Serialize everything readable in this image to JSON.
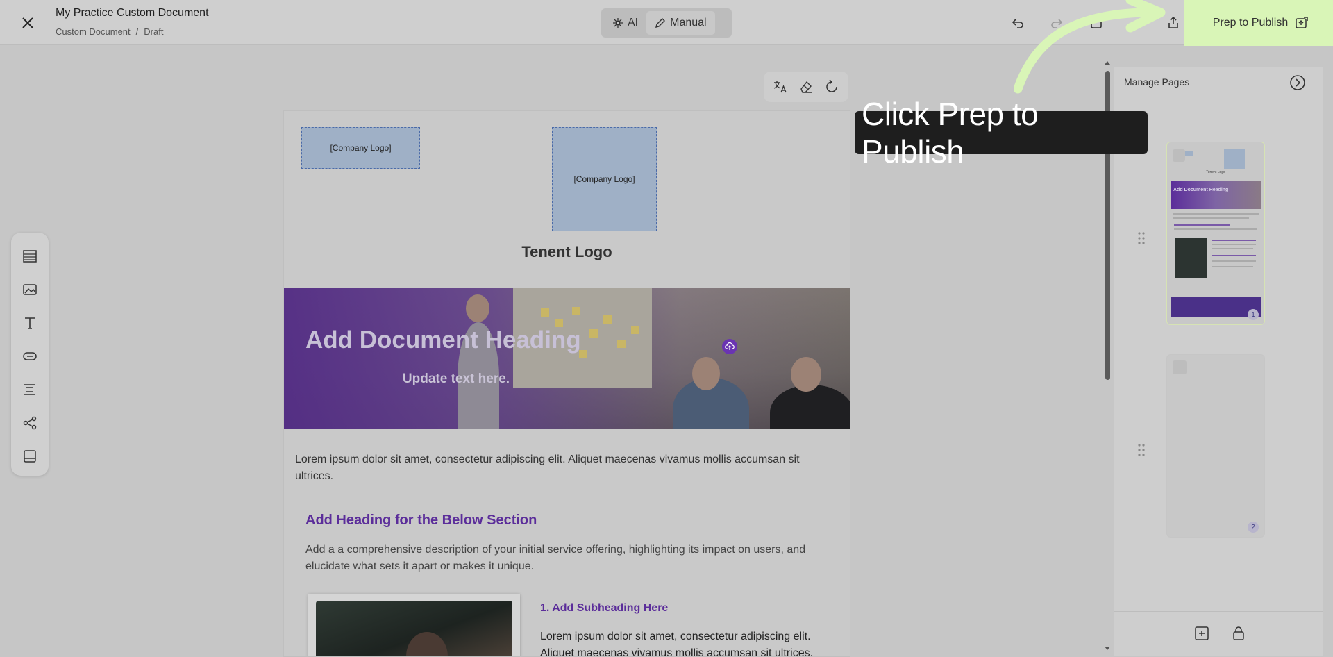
{
  "header": {
    "doc_title": "My Practice Custom Document",
    "breadcrumb": [
      "Custom Document",
      "/",
      "Draft"
    ],
    "mode_ai_label": "AI",
    "mode_manual_label": "Manual",
    "publish_label": "Prep to Publish"
  },
  "document": {
    "logo_small": "[Company Logo]",
    "logo_large": "[Company Logo]",
    "tenent_logo": "Tenent Logo",
    "banner_heading": "Add Document Heading",
    "banner_sub": "Update text here.",
    "intro_paragraph": "Lorem ipsum dolor sit amet, consectetur adipiscing elit. Aliquet maecenas vivamus mollis accumsan sit ultrices.",
    "section_heading": "Add Heading for the Below Section",
    "section_desc": "Add a a comprehensive description of your initial service offering, highlighting its impact on users, and elucidate what sets it apart or makes it unique.",
    "subheading": "1. Add Subheading Here",
    "sub_paragraph": "Lorem ipsum dolor sit amet, consectetur adipiscing elit. Aliquet maecenas vivamus mollis accumsan sit ultrices."
  },
  "right_panel": {
    "title": "Manage Pages",
    "pages": [
      {
        "number": "1",
        "thumb_heading": "Add Document Heading",
        "thumb_logo": "Tenent Logo"
      },
      {
        "number": "2"
      }
    ]
  },
  "callout": {
    "text": "Click Prep to Publish"
  },
  "colors": {
    "accent": "#5b2d9a",
    "highlight": "#d9f5b7",
    "callout_bg": "#1e1e1e"
  },
  "icons": {
    "close": "close-icon",
    "undo": "undo-icon",
    "redo": "redo-icon",
    "share": "share-icon",
    "publish": "publish-icon"
  }
}
